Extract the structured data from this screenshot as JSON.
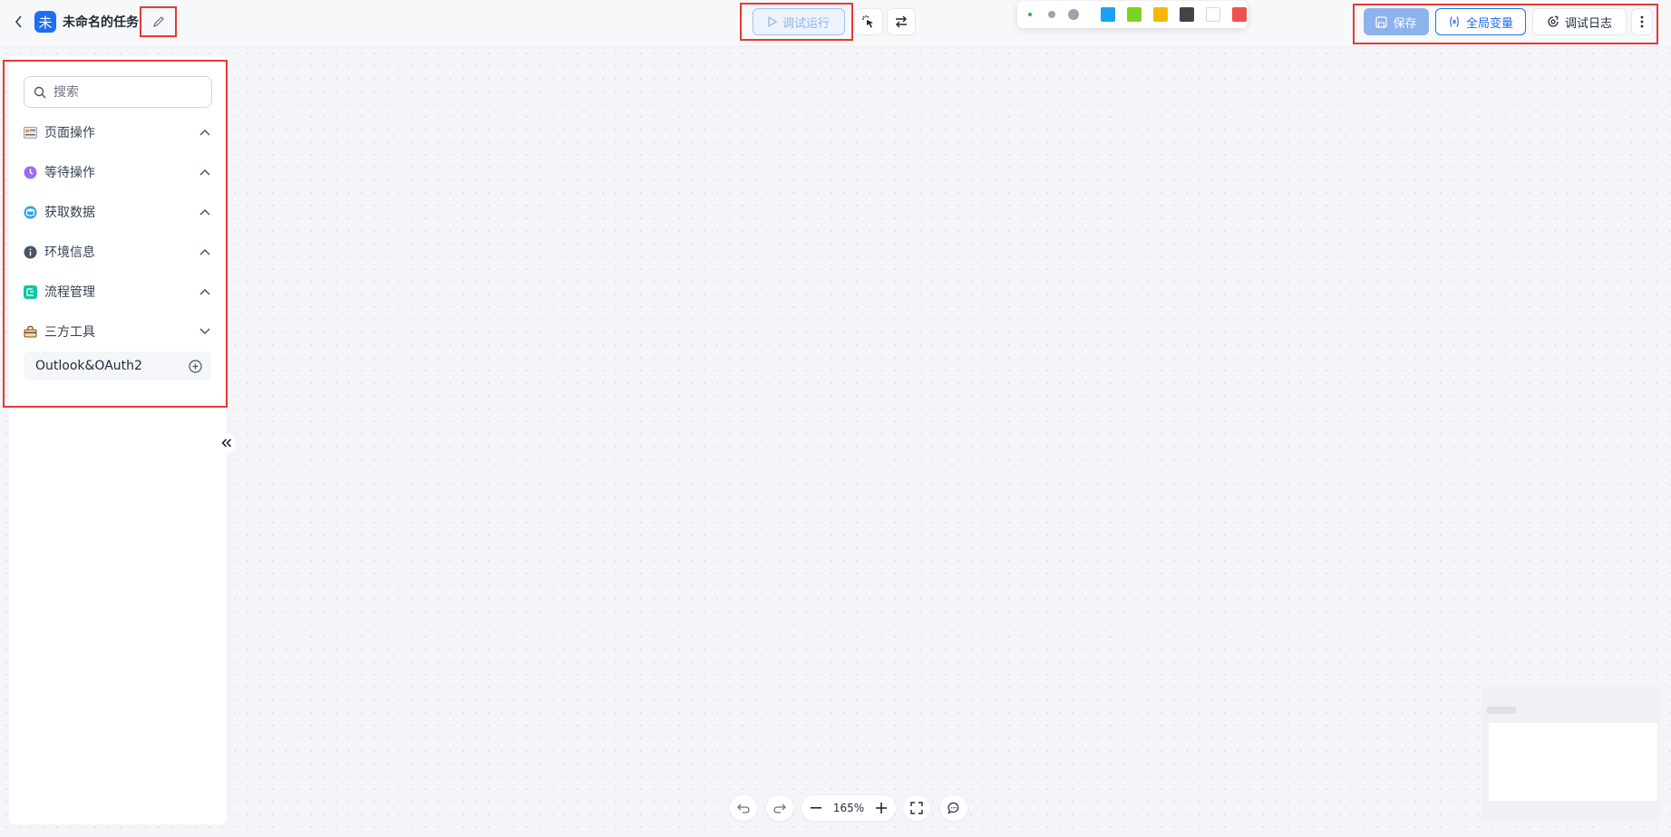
{
  "header": {
    "task_avatar": "未",
    "task_title": "未命名的任务",
    "run_label": "调试运行"
  },
  "palette": {
    "dots": [
      "small-dot",
      "medium-dot",
      "large-dot"
    ],
    "swatches": [
      "#1da1f2",
      "#7ed321",
      "#f5b800",
      "#444444",
      "#ffffff",
      "#f05050"
    ]
  },
  "toolbar": {
    "save_label": "保存",
    "global_var_label": "全局变量",
    "debug_log_label": "调试日志"
  },
  "sidebar": {
    "search_placeholder": "搜索",
    "categories": [
      {
        "label": "页面操作",
        "icon": "page-ops-icon",
        "expanded": true
      },
      {
        "label": "等待操作",
        "icon": "wait-ops-icon",
        "expanded": true
      },
      {
        "label": "获取数据",
        "icon": "fetch-data-icon",
        "expanded": true
      },
      {
        "label": "环境信息",
        "icon": "env-info-icon",
        "expanded": true
      },
      {
        "label": "流程管理",
        "icon": "flow-mgmt-icon",
        "expanded": true
      },
      {
        "label": "三方工具",
        "icon": "third-party-tools-icon",
        "expanded": false
      }
    ],
    "sub_items": [
      {
        "label": "Outlook&OAuth2"
      }
    ]
  },
  "zoom": {
    "level": "165%"
  },
  "colors": {
    "accent": "#1d6ff2",
    "highlight_border": "#e53935"
  }
}
